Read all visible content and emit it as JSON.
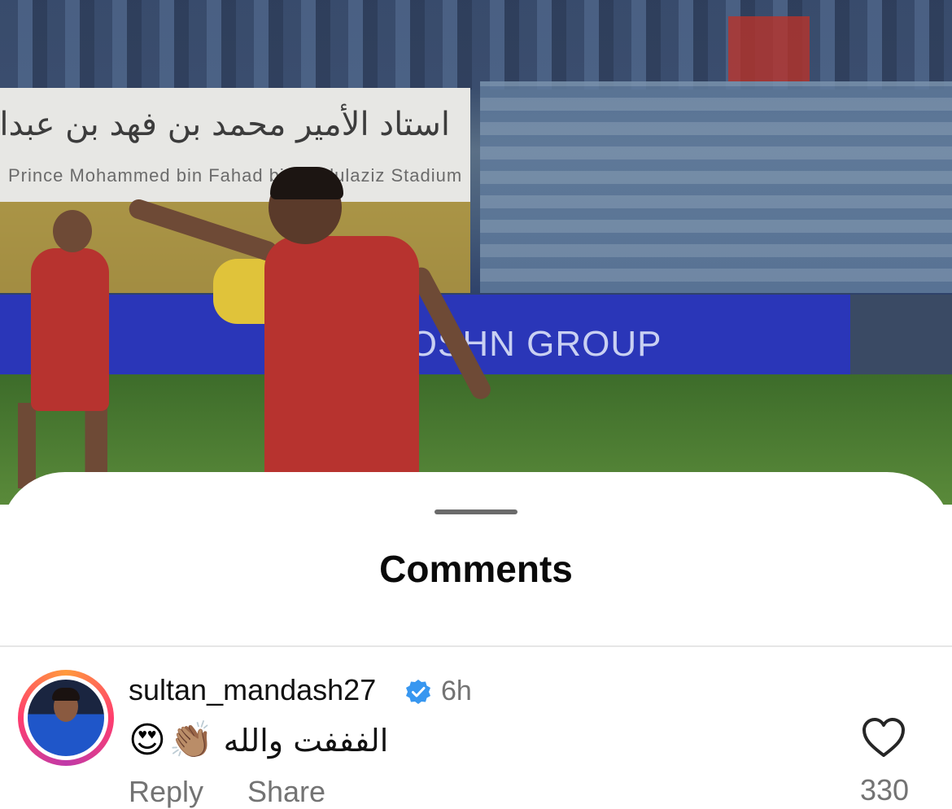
{
  "video": {
    "banner_arabic": "استاد الأمير محمد بن فهد بن عبدالعزيز",
    "banner_english": "Prince Mohammed bin Fahad bin Abdulaziz Stadium",
    "sponsor_board": "ROSHN GROUP"
  },
  "sheet": {
    "title": "Comments"
  },
  "comment": {
    "username": "sultan_mandash27",
    "verified": true,
    "time": "6h",
    "emoji_1": "😍",
    "emoji_2": "👏🏽",
    "text": "الفففت والله",
    "reply_label": "Reply",
    "share_label": "Share",
    "like_count": "330"
  },
  "colors": {
    "verified_blue": "#3897f0",
    "avatar_ring": [
      "#ff9a3c",
      "#ff3d6e",
      "#c03aa8"
    ],
    "meta_gray": "#737373"
  },
  "icons": {
    "verified": "verified-badge-icon",
    "like": "heart-icon"
  }
}
